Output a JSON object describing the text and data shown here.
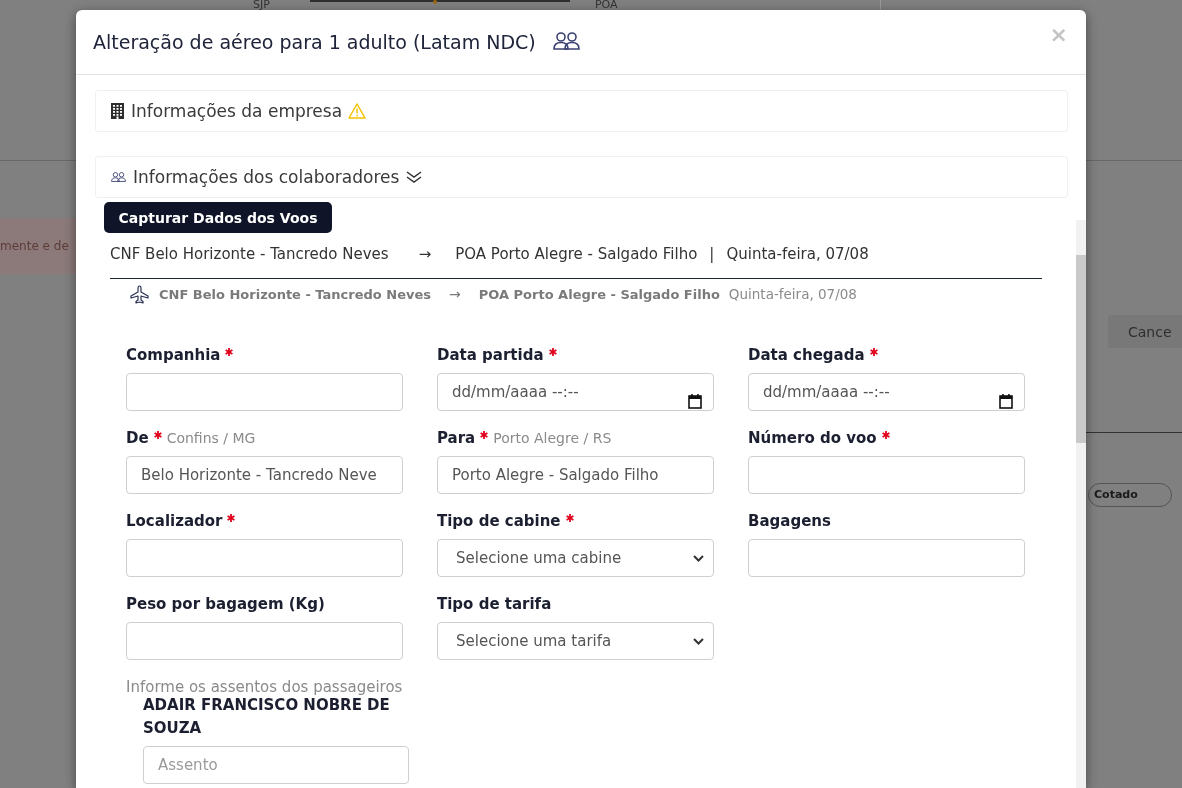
{
  "background": {
    "top_labels": [
      "SJP",
      "POA"
    ],
    "banner_text": "mente e de",
    "cancel_button": "Cance",
    "status_badge": "Cotado"
  },
  "modal": {
    "title": "Alteração de aéreo para 1 adulto (Latam NDC)",
    "close": "×",
    "sections": [
      {
        "kind": "company",
        "title": "Informações da empresa",
        "warning": true
      },
      {
        "kind": "employees",
        "title": "Informações dos colaboradores",
        "warning": false
      }
    ],
    "capture_button": "Capturar Dados dos Voos",
    "route_summary": {
      "origin": "CNF Belo Horizonte - Tancredo Neves",
      "arrow": "→",
      "destination": "POA Porto Alegre - Salgado Filho",
      "separator": "|",
      "date": "Quinta-feira, 07/08"
    },
    "segment": {
      "origin": "CNF Belo Horizonte - Tancredo Neves",
      "arrow": "→",
      "destination": "POA Porto Alegre - Salgado Filho",
      "date": "Quinta-feira, 07/08"
    },
    "fields": [
      {
        "kind": "text",
        "label": "Companhia",
        "required": true
      },
      {
        "kind": "datetime",
        "label": "Data partida",
        "required": true,
        "placeholder": "dd/mm/aaaa --:--"
      },
      {
        "kind": "datetime",
        "label": "Data chegada",
        "required": true,
        "placeholder": "dd/mm/aaaa --:--"
      },
      {
        "kind": "text",
        "label": "De",
        "required": true,
        "hint": "Confins / MG",
        "value": "Belo Horizonte - Tancredo Neve"
      },
      {
        "kind": "text",
        "label": "Para",
        "required": true,
        "hint": "Porto Alegre / RS",
        "value": "Porto Alegre - Salgado Filho"
      },
      {
        "kind": "text",
        "label": "Número do voo",
        "required": true
      },
      {
        "kind": "text",
        "label": "Localizador",
        "required": true
      },
      {
        "kind": "select",
        "label": "Tipo de cabine",
        "required": true,
        "placeholder": "Selecione uma cabine"
      },
      {
        "kind": "text",
        "label": "Bagagens",
        "required": false
      },
      {
        "kind": "text",
        "label": "Peso por bagagem (Kg)",
        "required": false
      },
      {
        "kind": "select",
        "label": "Tipo de tarifa",
        "required": false,
        "placeholder": "Selecione uma tarifa"
      }
    ],
    "seat_prompt": "Informe os assentos dos passageiros",
    "passengers": [
      {
        "name": "ADAIR FRANCISCO NOBRE DE SOUZA",
        "placeholder": "Assento"
      }
    ]
  }
}
